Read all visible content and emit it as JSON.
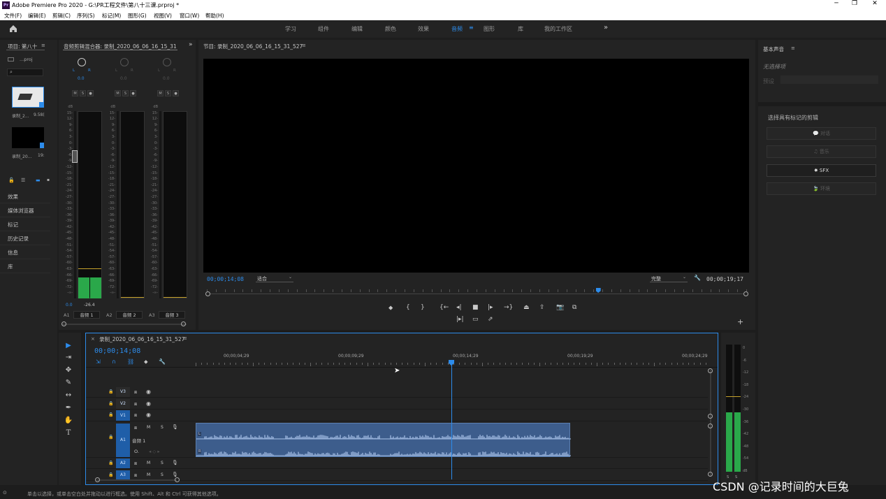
{
  "window": {
    "title": "Adobe Premiere Pro 2020 - G:\\PR工程文件\\第八十三课.prproj *",
    "app_badge": "Pr"
  },
  "menu": [
    "文件(F)",
    "编辑(E)",
    "剪辑(C)",
    "序列(S)",
    "标记(M)",
    "图形(G)",
    "视图(V)",
    "窗口(W)",
    "帮助(H)"
  ],
  "workspaces": {
    "tabs": [
      "学习",
      "组件",
      "编辑",
      "颜色",
      "效果",
      "音频",
      "图形",
      "库",
      "我的工作区"
    ],
    "active": "音频",
    "more": "»"
  },
  "project": {
    "title": "项目: 第八十",
    "file": "...proj",
    "clips": [
      {
        "name": "录制_2...",
        "size": "9.58("
      },
      {
        "name": "录制_20...",
        "size": "19:"
      }
    ]
  },
  "left_panels": [
    "效果",
    "媒体浏览器",
    "标记",
    "历史记录",
    "信息",
    "库"
  ],
  "mixer": {
    "title": "音频剪辑混合器: 录制_2020_06_06_16_15_31",
    "scale": [
      "dB",
      "15-",
      "12-",
      "9-",
      "6-",
      "3-",
      "0-",
      "-3-",
      "-6-",
      "-9-",
      "-12-",
      "-15-",
      "-18-",
      "-21-",
      "-24-",
      "-27-",
      "-30-",
      "-33-",
      "-36-",
      "-39-",
      "-42-",
      "-45-",
      "-48-",
      "-51-",
      "-54-",
      "-57-",
      "-60-",
      "-63-",
      "-66-",
      "-69-",
      "-72-",
      "-∞-"
    ],
    "channels": [
      {
        "id": "A1",
        "name": "音频 1",
        "pan": "0.0",
        "lr": "L",
        "lr2": "R",
        "left_val": "0.0",
        "right_val": "-26.4",
        "level": 0.09
      },
      {
        "id": "A2",
        "name": "音频 2",
        "pan": "0.0",
        "lr": "L",
        "lr2": "R",
        "left_val": "",
        "right_val": "",
        "level": 0
      },
      {
        "id": "A3",
        "name": "音频 3",
        "pan": "0.0",
        "lr": "L",
        "lr2": "R",
        "left_val": "",
        "right_val": "",
        "level": 0
      }
    ],
    "msr": [
      "M",
      "S",
      "●"
    ]
  },
  "program": {
    "title": "节目: 录制_2020_06_06_16_15_31_527",
    "timecode": "00;00;14;08",
    "fit": "适合",
    "quality": "完整",
    "duration": "00;00;19;17",
    "playhead": 0.725
  },
  "essential": {
    "title": "基本声音",
    "no_selection": "无选择项",
    "preset_label": "预设",
    "prompt": "选择具有标记的剪辑",
    "buttons": [
      {
        "icon": "speech-icon",
        "label": "对话",
        "enabled": false
      },
      {
        "icon": "music-icon",
        "label": "音乐",
        "enabled": false
      },
      {
        "icon": "sfx-icon",
        "label": "SFX",
        "enabled": true
      },
      {
        "icon": "ambience-icon",
        "label": "环境",
        "enabled": false
      }
    ]
  },
  "timeline": {
    "tab": "录制_2020_06_06_16_15_31_527",
    "timecode": "00;00;14;08",
    "ruler": [
      "00;00;04;29",
      "00;00;09;29",
      "00;00;14;29",
      "00;00;19;29",
      "00;00;24;29"
    ],
    "video_tracks": [
      "V3",
      "V2",
      "V1"
    ],
    "audio_tracks": [
      "A1",
      "A2",
      "A3"
    ],
    "a1_name": "音频 1",
    "msr": [
      "M",
      "S"
    ],
    "clip_badges": [
      "L",
      "R"
    ],
    "tools": [
      "selection-tool",
      "track-select-tool",
      "ripple-edit-tool",
      "razor-tool",
      "slip-tool",
      "pen-tool",
      "hand-tool",
      "type-tool"
    ]
  },
  "vu_scale": [
    "0",
    "-6",
    "-12",
    "-18",
    "-24",
    "-30",
    "-36",
    "-42",
    "-48",
    "-54",
    "dB"
  ],
  "vu_labels": [
    "S",
    "S"
  ],
  "status": {
    "text": "单击以选择，或单击空白处并拖动以进行框选。使用 Shift、Alt 和 Ctrl 可获得其他选项。"
  },
  "watermark": "CSDN @记录时间的大巨兔",
  "colors": {
    "accent": "#2d8ceb",
    "clip": "#3d5d8c",
    "meter_green": "#2aa84a",
    "peak": "#c6a22b"
  }
}
